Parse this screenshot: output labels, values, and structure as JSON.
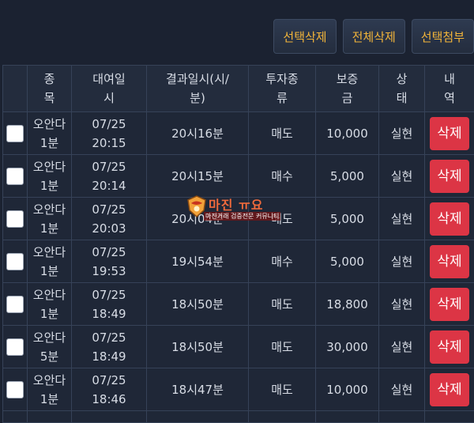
{
  "toolbar": {
    "delete_selected": "선택삭제",
    "delete_all": "전체삭제",
    "attach_selected": "선택첨부"
  },
  "table": {
    "headers": {
      "item": [
        "종",
        "목"
      ],
      "rent_time": [
        "대여일",
        "시"
      ],
      "result_time": [
        "결과일시(시/",
        "분)"
      ],
      "type": [
        "투자종",
        "류"
      ],
      "deposit": [
        "보증",
        "금"
      ],
      "status": [
        "상",
        "태"
      ],
      "detail": [
        "내",
        "역"
      ]
    },
    "rows": [
      {
        "item": [
          "오안다",
          "1분"
        ],
        "date": [
          "07/25",
          "20:15"
        ],
        "result": "20시16분",
        "type": "매도",
        "deposit": "10,000",
        "status": "실현",
        "action": "삭제"
      },
      {
        "item": [
          "오안다",
          "1분"
        ],
        "date": [
          "07/25",
          "20:14"
        ],
        "result": "20시15분",
        "type": "매수",
        "deposit": "5,000",
        "status": "실현",
        "action": "삭제"
      },
      {
        "item": [
          "오안다",
          "1분"
        ],
        "date": [
          "07/25",
          "20:03"
        ],
        "result": "20시04분",
        "type": "매도",
        "deposit": "5,000",
        "status": "실현",
        "action": "삭제"
      },
      {
        "item": [
          "오안다",
          "1분"
        ],
        "date": [
          "07/25",
          "19:53"
        ],
        "result": "19시54분",
        "type": "매수",
        "deposit": "5,000",
        "status": "실현",
        "action": "삭제"
      },
      {
        "item": [
          "오안다",
          "1분"
        ],
        "date": [
          "07/25",
          "18:49"
        ],
        "result": "18시50분",
        "type": "매도",
        "deposit": "18,800",
        "status": "실현",
        "action": "삭제"
      },
      {
        "item": [
          "오안다",
          "5분"
        ],
        "date": [
          "07/25",
          "18:49"
        ],
        "result": "18시50분",
        "type": "매도",
        "deposit": "30,000",
        "status": "실현",
        "action": "삭제"
      },
      {
        "item": [
          "오안다",
          "1분"
        ],
        "date": [
          "07/25",
          "18:46"
        ],
        "result": "18시47분",
        "type": "매도",
        "deposit": "10,000",
        "status": "실현",
        "action": "삭제"
      }
    ]
  },
  "watermark": {
    "title": "마진 ㅠ요",
    "subtitle": "마진거래 검증전문 커뮤니티"
  },
  "colors": {
    "accent": "#f3b53a",
    "danger": "#dc3545",
    "success": "#3fae49"
  }
}
